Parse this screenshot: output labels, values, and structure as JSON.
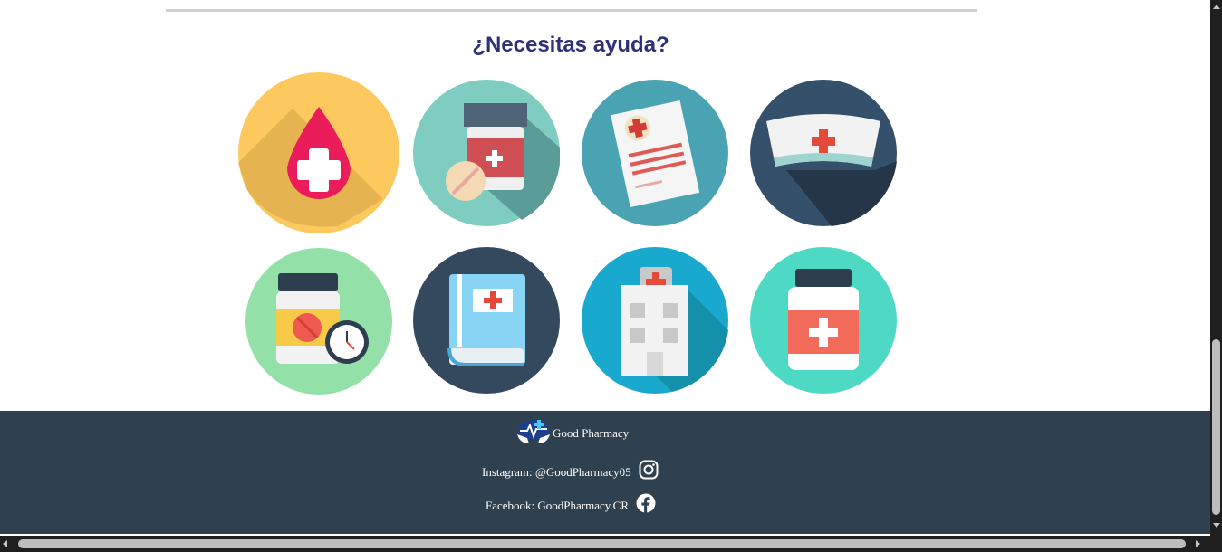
{
  "help": {
    "title": "¿Necesitas ayuda?",
    "services": [
      {
        "icon": "blood-drop-icon",
        "bg": "#fdc95e"
      },
      {
        "icon": "pill-bottle-icon",
        "bg": "#7ecdc0"
      },
      {
        "icon": "prescription-icon",
        "bg": "#4aa3b2"
      },
      {
        "icon": "nurse-cap-icon",
        "bg": "#34506a"
      },
      {
        "icon": "medicine-schedule-icon",
        "bg": "#93e0a9"
      },
      {
        "icon": "medical-book-icon",
        "bg": "#34495e"
      },
      {
        "icon": "hospital-icon",
        "bg": "#19a9cf"
      },
      {
        "icon": "medicine-jar-icon",
        "bg": "#4dd9c4"
      }
    ]
  },
  "footer": {
    "brand": "Good Pharmacy",
    "instagram": "Instagram: @GoodPharmacy05",
    "facebook": "Facebook: GoodPharmacy.CR"
  },
  "colors": {
    "title": "#2e3176",
    "footer_bg": "#2f404f",
    "divider": "#d0d0d0"
  }
}
